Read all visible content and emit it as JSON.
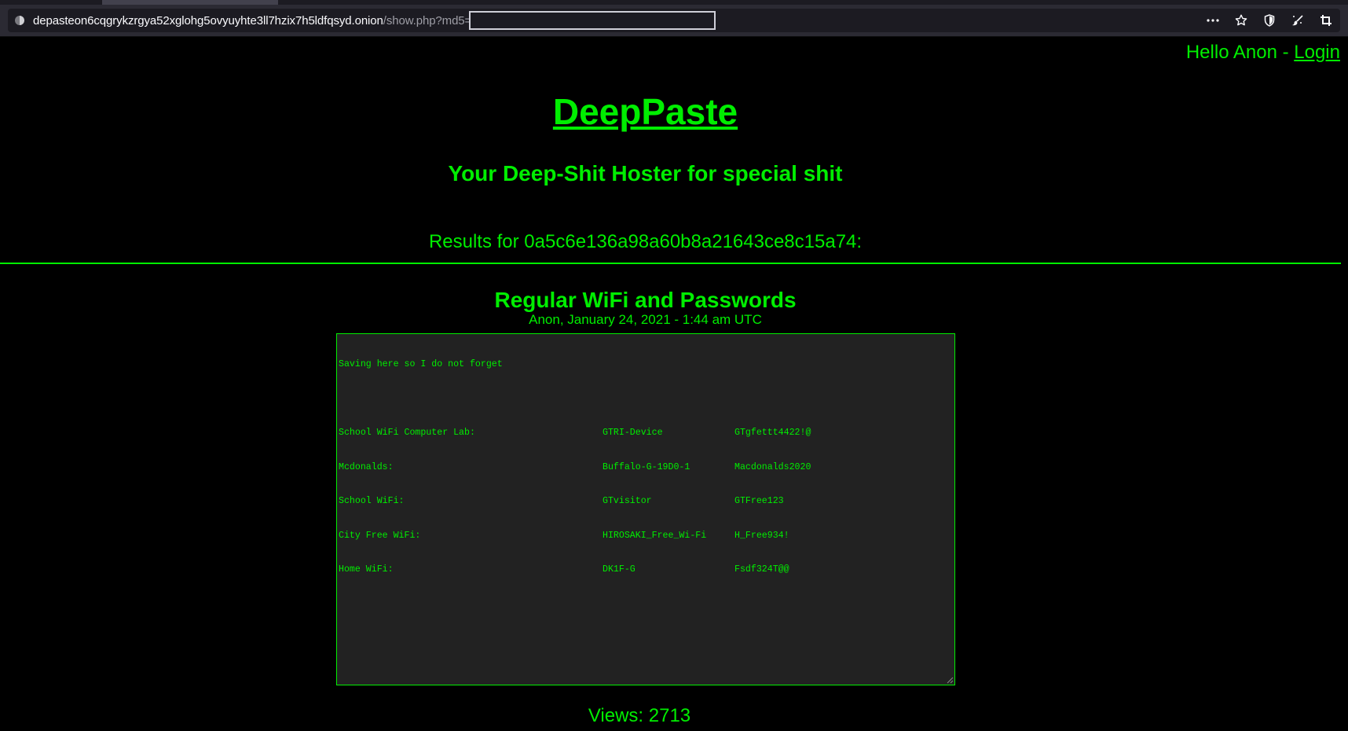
{
  "browser": {
    "url_domain": "depasteon6cqgrykzrgya52xglohg5ovyuyhte3ll7hzix7h5ldfqsyd.onion",
    "url_path": "/show.php?md5=",
    "icons": [
      "site-info-icon",
      "more-actions-icon",
      "bookmark-star-icon",
      "shield-icon",
      "brush-icon",
      "crop-icon"
    ]
  },
  "header": {
    "greeting_text": "Hello Anon - ",
    "login_link": "Login"
  },
  "site": {
    "title": "DeepPaste",
    "tagline": "Your Deep-Shit Hoster for special shit"
  },
  "results": {
    "heading": "Results for 0a5c6e136a98a60b8a21643ce8c15a74:"
  },
  "paste": {
    "title": "Regular WiFi and Passwords",
    "meta": "Anon, January 24, 2021 - 1:44 am UTC",
    "intro": "Saving here so I do not forget",
    "rows": [
      {
        "label": "School WiFi Computer Lab:",
        "network": "GTRI-Device",
        "password": "GTgfettt4422!@"
      },
      {
        "label": "Mcdonalds:",
        "network": "Buffalo-G-19D0-1",
        "password": "Macdonalds2020"
      },
      {
        "label": "School WiFi:",
        "network": "GTvisitor",
        "password": "GTFree123"
      },
      {
        "label": "City Free WiFi:",
        "network": "HIROSAKI_Free_Wi-Fi",
        "password": "H_Free934!"
      },
      {
        "label": "Home WiFi:",
        "network": "DK1F-G",
        "password": "Fsdf324T@@"
      }
    ],
    "views_text": "Views: 2713"
  },
  "colors": {
    "accent": "#00ee00",
    "background": "#000000",
    "textarea_bg": "#222222"
  }
}
